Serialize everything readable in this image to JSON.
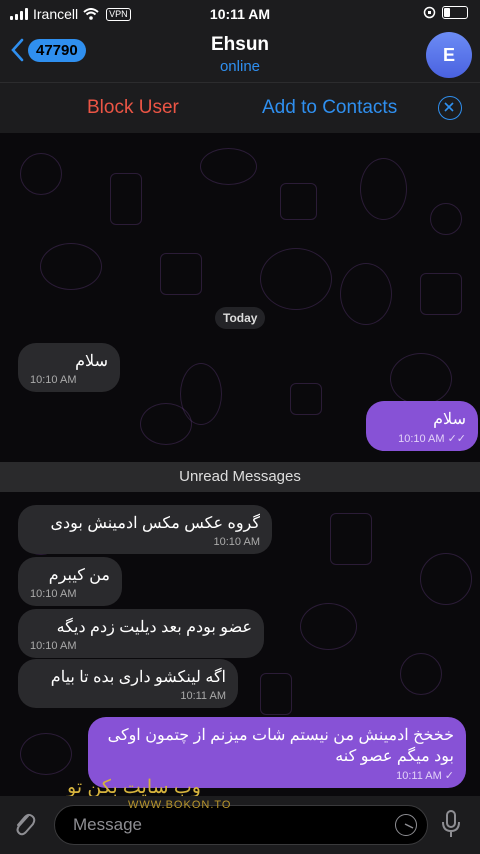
{
  "status": {
    "carrier": "Irancell",
    "vpn": "VPN",
    "time": "10:11 AM"
  },
  "header": {
    "back_count": "47790",
    "title": "Ehsun",
    "subtitle": "online",
    "avatar_letter": "E"
  },
  "actions": {
    "block": "Block User",
    "add": "Add to Contacts"
  },
  "chat": {
    "date_pill": "Today",
    "unread_label": "Unread Messages",
    "messages": [
      {
        "text": "سلام",
        "time": "10:10 AM"
      },
      {
        "text": "سلام",
        "time": "10:10 AM"
      },
      {
        "text": "گروه عکس مکس ادمینش بودی",
        "time": "10:10 AM"
      },
      {
        "text": "من کیبرم",
        "time": "10:10 AM"
      },
      {
        "text": "عضو بودم بعد دیلیت زدم دیگه",
        "time": "10:10 AM"
      },
      {
        "text": "اگه لینکشو داری بده تا بیام",
        "time": "10:11 AM"
      },
      {
        "text": "خخخخ ادمینش من نیستم شات میزنم از چتمون اوکی بود میگم عصو کنه",
        "time": "10:11 AM"
      }
    ]
  },
  "watermark": {
    "line1": "وب سایت بکن تو",
    "line2": "WWW.BOKON.TO"
  },
  "input": {
    "placeholder": "Message"
  },
  "colors": {
    "accent": "#2f8fef",
    "danger": "#eb5545",
    "outgoing": "#8752d6",
    "incoming": "#2a2a2d"
  }
}
